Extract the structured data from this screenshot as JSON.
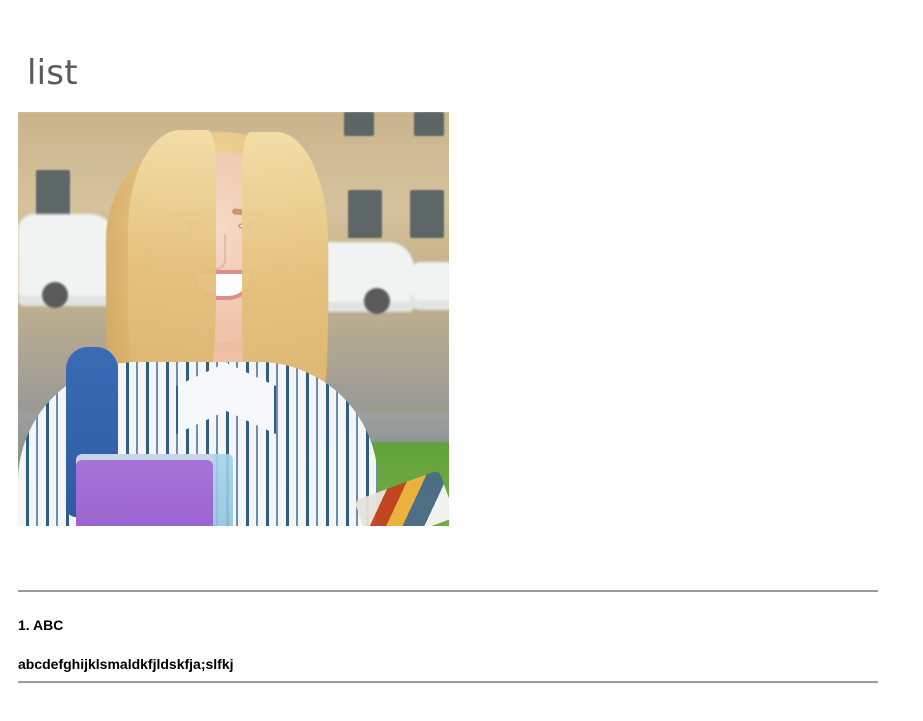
{
  "page": {
    "title": "list"
  },
  "hero_image": {
    "alt": "",
    "accent_colors": {
      "hair": "#e5c27f",
      "backpack": "#2e5aa2",
      "book": "#9b63d0",
      "grass": "#6aa63f"
    }
  },
  "list": {
    "items": [
      {
        "heading": "1. ABC",
        "text": "abcdefghijklsmaldkfjldskfja;slfkj"
      }
    ]
  },
  "colors": {
    "title_text": "#5a5a5a",
    "divider": "#9c9c9c",
    "body_text": "#000000",
    "background": "#ffffff"
  }
}
